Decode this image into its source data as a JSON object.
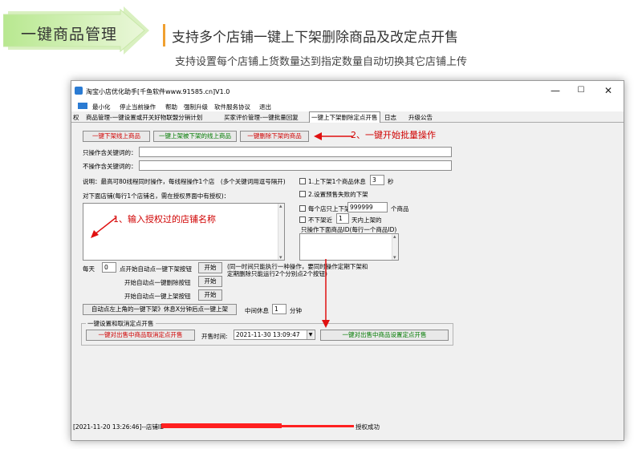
{
  "banner": {
    "title": "一键商品管理"
  },
  "headline": "支持多个店铺一键上下架删除商品及改定点开售",
  "subline": "支持设置每个店铺上货数量达到指定数量自动切换其它店铺上传",
  "window": {
    "title": "淘宝小店优化助手[千鱼软件www.91585.cn]V1.0",
    "controls": {
      "minimize": "—",
      "maximize": "☐",
      "close": "✕"
    }
  },
  "menu": [
    "最小化",
    "停止当前操作",
    "帮助",
    "强制升级",
    "软件服务协议",
    "退出"
  ],
  "tabs": [
    "权",
    "商品管理-一键设置或开关好物联盟分销计划",
    "买家评价管理-一键批量回复",
    "一键上下架删除定点开售",
    "日志",
    "升级公告"
  ],
  "toolbar": {
    "btn_down_up": "一键下架线上商品",
    "btn_up": "一键上架被下架的线上商品",
    "btn_delete": "一键删除下架的商品"
  },
  "annotations": {
    "step2": "2、一键开始批量操作",
    "step1": "1、输入授权过的店铺名称"
  },
  "keywords": {
    "label1": "只操作含关键词的：",
    "label2": "不操作含关键词的："
  },
  "notes": {
    "thread_note": "说明：最高可80线程同时操作，每线程操作1个店　(多个关键词用逗号隔开)",
    "shop_label": "对下面店铺(每行1个店铺名，需在授权界面中有授权)："
  },
  "options": {
    "opt1_prefix": "1.上下架1个商品休息",
    "opt1_value": "3",
    "opt1_suffix": "秒",
    "opt2": "2.设置预售失败的下架",
    "opt3_prefix": "每个店只上下架",
    "opt3_value": "999999",
    "opt3_suffix": "个商品",
    "opt4_prefix": "不下架近",
    "opt4_value": "1",
    "opt4_suffix": "天内上架的",
    "list_label": "只操作下面商品ID(每行一个商品ID)"
  },
  "schedule": {
    "daily_label": "每天",
    "daily_value": "0",
    "row1_label": "点开始自动点一键下架按钮",
    "row2_label": "开始自动点一键删除按钮",
    "row3_label": "开始自动点一键上架按钮",
    "start_label": "开始",
    "note": "(同一时间只能执行一种操作，要同时操作定期下架和定期删除只能运行2个分别点2个按钮)"
  },
  "auto": {
    "button": "自动点左上角的一键下架》休息X分钟后点一键上架",
    "rest_label": "中间休息",
    "rest_value": "1",
    "rest_unit": "分钟"
  },
  "presale": {
    "group_title": "一键设置和取消定点开售",
    "cancel_button": "一键对出售中商品取消定点开售",
    "time_label": "开售时间:",
    "time_value": "2021-11-30 13:09:47",
    "set_button": "一键对出售中商品设置定点开售"
  },
  "status": {
    "prefix": "[2021-11-20 13:26:46]--店铺ID",
    "suffix": "授权成功"
  }
}
